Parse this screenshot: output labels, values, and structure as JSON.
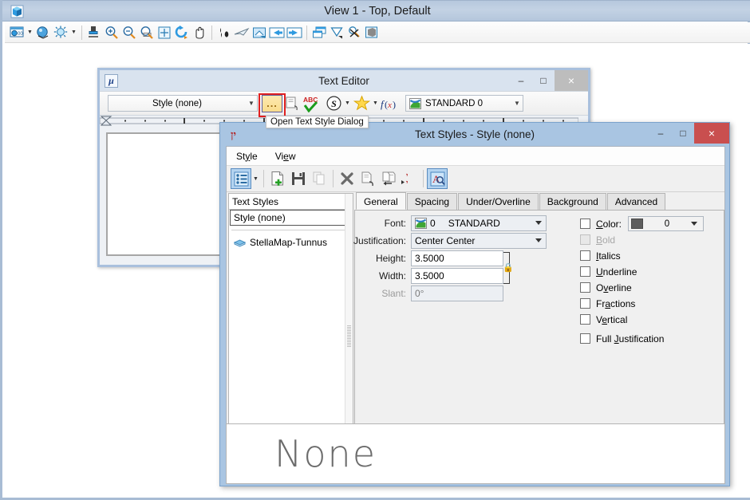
{
  "app": {
    "title": "View 1 - Top, Default",
    "icon": "cube-icon",
    "toolbar": [
      {
        "name": "view-attributes-icon",
        "dropdown": true
      },
      {
        "name": "render-mode-icon",
        "dropdown": false
      },
      {
        "name": "display-style-icon",
        "dropdown": true
      },
      {
        "name": "sep",
        "dropdown": false
      },
      {
        "name": "clip-volume-icon",
        "dropdown": false
      },
      {
        "name": "zoom-in-icon",
        "dropdown": false
      },
      {
        "name": "zoom-out-icon",
        "dropdown": false
      },
      {
        "name": "window-area-icon",
        "dropdown": false
      },
      {
        "name": "fit-view-icon",
        "dropdown": false
      },
      {
        "name": "rotate-view-icon",
        "dropdown": false
      },
      {
        "name": "pan-view-icon",
        "dropdown": false
      },
      {
        "name": "sep",
        "dropdown": false
      },
      {
        "name": "walk-icon",
        "dropdown": false
      },
      {
        "name": "fly-icon",
        "dropdown": false
      },
      {
        "name": "view-previous-next-icon",
        "dropdown": false
      },
      {
        "name": "previous-view-icon",
        "dropdown": false
      },
      {
        "name": "next-view-icon",
        "dropdown": false
      },
      {
        "name": "sep",
        "dropdown": false
      },
      {
        "name": "copy-view-icon",
        "dropdown": false
      },
      {
        "name": "clip-mask-icon",
        "dropdown": false
      },
      {
        "name": "clip-element-icon",
        "dropdown": false
      },
      {
        "name": "clear-clip-icon",
        "dropdown": false
      }
    ]
  },
  "text_editor": {
    "title": "Text Editor",
    "icon": "mu-icon",
    "style_combo": "Style (none)",
    "ellipsis_label": "...",
    "font_combo": "STANDARD 0",
    "controls": {
      "minimize": "–",
      "maximize": "□",
      "close": "×"
    },
    "toolbar_icons": [
      "insert-field-icon",
      "spell-check-icon",
      "symbol-icon",
      "favorites-icon",
      "function-icon"
    ]
  },
  "tooltip": {
    "text": "Open Text Style Dialog"
  },
  "text_styles_dialog": {
    "title": "Text Styles - Style (none)",
    "icon": "text-style-icon",
    "controls": {
      "minimize": "–",
      "maximize": "□",
      "close": "×"
    },
    "menu": [
      {
        "label": "Style",
        "accel": "y"
      },
      {
        "label": "View",
        "accel": "e"
      }
    ],
    "toolbar_icons": [
      "style-list-icon",
      "new-style-icon",
      "save-style-icon",
      "copy-style-icon",
      "delete-style-icon",
      "update-from-element-icon",
      "apply-to-element-icon",
      "import-styles-icon",
      "highlight-style-icon"
    ],
    "left_panel": {
      "header": "Text Styles",
      "selected_style": "Style (none)",
      "tree_items": [
        {
          "label": "StellaMap-Tunnus",
          "icon": "style-group-icon"
        }
      ]
    },
    "tabs": [
      {
        "label": "General",
        "active": true
      },
      {
        "label": "Spacing",
        "active": false
      },
      {
        "label": "Under/Overline",
        "active": false
      },
      {
        "label": "Background",
        "active": false
      },
      {
        "label": "Advanced",
        "active": false
      }
    ],
    "general": {
      "font_label": "Font:",
      "font_index": "0",
      "font_value": "STANDARD",
      "font_icon": "font-icon",
      "justification_label": "Justification:",
      "justification_value": "Center Center",
      "height_label": "Height:",
      "height_value": "3.5000",
      "width_label": "Width:",
      "width_value": "3.5000",
      "slant_label": "Slant:",
      "slant_value": "0°",
      "slant_disabled": true,
      "lock_icon": "lock-icon",
      "checkboxes": [
        {
          "label": "Color:",
          "accel": "C",
          "checked": false,
          "disabled": false,
          "name": "color"
        },
        {
          "label": "Bold",
          "accel": "B",
          "checked": false,
          "disabled": true,
          "name": "bold"
        },
        {
          "label": "Italics",
          "accel": "I",
          "checked": false,
          "disabled": false,
          "name": "italics"
        },
        {
          "label": "Underline",
          "accel": "U",
          "checked": false,
          "disabled": false,
          "name": "underline"
        },
        {
          "label": "Overline",
          "accel": "v",
          "checked": false,
          "disabled": false,
          "name": "overline"
        },
        {
          "label": "Fractions",
          "accel": "a",
          "checked": false,
          "disabled": false,
          "name": "fractions"
        },
        {
          "label": "Vertical",
          "accel": "e",
          "checked": false,
          "disabled": false,
          "name": "vertical"
        },
        {
          "label": "Full Justification",
          "accel": "J",
          "checked": false,
          "disabled": false,
          "name": "full-justification"
        }
      ],
      "color_value": "0",
      "color_swatch_hex": "#5e5e5e"
    },
    "preview_text": "None"
  },
  "colors": {
    "titlebar_start": "#b6c8dd",
    "titlebar_end": "#b4c6dc",
    "dialog_frame": "#a9c5e2",
    "selection_red": "#e02020",
    "close_red": "#c94f4f",
    "tab_active": "#f7f7f7",
    "panel_bg": "#f0f0f0"
  }
}
